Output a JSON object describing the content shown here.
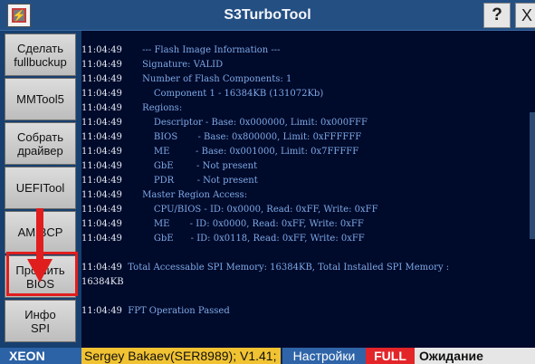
{
  "window": {
    "title": "S3TurboTool",
    "help_label": "?",
    "close_label": "X",
    "app_icon_glyph": "⚡"
  },
  "sidebar": {
    "items": [
      {
        "label": "Сделать\nfullbuckup"
      },
      {
        "label": "MMTool5"
      },
      {
        "label": "Собрать\nдрайвер"
      },
      {
        "label": "UEFITool"
      },
      {
        "label": "AMIBCP"
      },
      {
        "label": "Прошить\nBIOS"
      },
      {
        "label": "Инфо\nSPI"
      }
    ],
    "highlight_color": "#e01e1e"
  },
  "log": {
    "lines": [
      {
        "time": "11:04:49",
        "text": "       --- Flash Image Information ---"
      },
      {
        "time": "11:04:49",
        "text": "       Signature: VALID"
      },
      {
        "time": "11:04:49",
        "text": "       Number of Flash Components: 1"
      },
      {
        "time": "11:04:49",
        "text": "           Component 1 - 16384KB (131072Kb)"
      },
      {
        "time": "11:04:49",
        "text": "       Regions:"
      },
      {
        "time": "11:04:49",
        "text": "           Descriptor - Base: 0x000000, Limit: 0x000FFF"
      },
      {
        "time": "11:04:49",
        "text": "           BIOS       - Base: 0x800000, Limit: 0xFFFFFF"
      },
      {
        "time": "11:04:49",
        "text": "           ME         - Base: 0x001000, Limit: 0x7FFFFF"
      },
      {
        "time": "11:04:49",
        "text": "           GbE        - Not present"
      },
      {
        "time": "11:04:49",
        "text": "           PDR        - Not present"
      },
      {
        "time": "11:04:49",
        "text": "       Master Region Access:"
      },
      {
        "time": "11:04:49",
        "text": "           CPU/BIOS - ID: 0x0000, Read: 0xFF, Write: 0xFF"
      },
      {
        "time": "11:04:49",
        "text": "           ME       - ID: 0x0000, Read: 0xFF, Write: 0xFF"
      },
      {
        "time": "11:04:49",
        "text": "           GbE      - ID: 0x0118, Read: 0xFF, Write: 0xFF"
      },
      {
        "time": "",
        "text": ""
      },
      {
        "time": "11:04:49",
        "text": "  Total Accessable SPI Memory: 16384KB, Total Installed SPI Memory :"
      },
      {
        "time": "16384KB",
        "text": ""
      },
      {
        "time": "",
        "text": ""
      },
      {
        "time": "11:04:49",
        "text": "  FPT Operation Passed"
      }
    ]
  },
  "status": {
    "cpu": "XEON",
    "author": "Sergey Bakaev(SER8989); V1.41;",
    "settings": "Настройки",
    "mode": "FULL",
    "state": "Ожидание"
  }
}
